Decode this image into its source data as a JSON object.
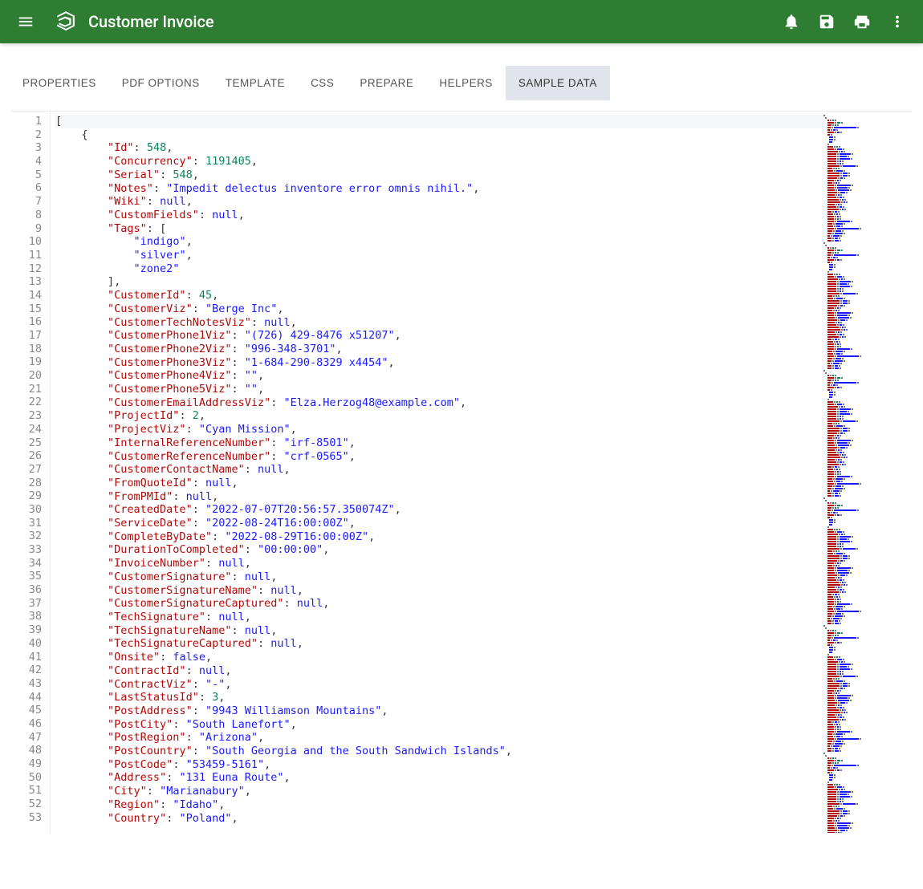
{
  "header": {
    "title": "Customer Invoice"
  },
  "tabs": [
    {
      "id": "properties",
      "label": "PROPERTIES",
      "active": false
    },
    {
      "id": "pdf-options",
      "label": "PDF OPTIONS",
      "active": false
    },
    {
      "id": "template",
      "label": "TEMPLATE",
      "active": false
    },
    {
      "id": "css",
      "label": "CSS",
      "active": false
    },
    {
      "id": "prepare",
      "label": "PREPARE",
      "active": false
    },
    {
      "id": "helpers",
      "label": "HELPERS",
      "active": false
    },
    {
      "id": "sample-data",
      "label": "SAMPLE DATA",
      "active": true
    }
  ],
  "editor": {
    "lines": [
      [
        {
          "t": "[",
          "c": "p"
        }
      ],
      [
        {
          "indent": 4
        },
        {
          "t": "{",
          "c": "p"
        }
      ],
      [
        {
          "indent": 8
        },
        {
          "t": "\"Id\"",
          "c": "k"
        },
        {
          "t": ": ",
          "c": "p"
        },
        {
          "t": "548",
          "c": "n"
        },
        {
          "t": ",",
          "c": "p"
        }
      ],
      [
        {
          "indent": 8
        },
        {
          "t": "\"Concurrency\"",
          "c": "k"
        },
        {
          "t": ": ",
          "c": "p"
        },
        {
          "t": "1191405",
          "c": "n"
        },
        {
          "t": ",",
          "c": "p"
        }
      ],
      [
        {
          "indent": 8
        },
        {
          "t": "\"Serial\"",
          "c": "k"
        },
        {
          "t": ": ",
          "c": "p"
        },
        {
          "t": "548",
          "c": "n"
        },
        {
          "t": ",",
          "c": "p"
        }
      ],
      [
        {
          "indent": 8
        },
        {
          "t": "\"Notes\"",
          "c": "k"
        },
        {
          "t": ": ",
          "c": "p"
        },
        {
          "t": "\"Impedit delectus inventore error omnis nihil.\"",
          "c": "s"
        },
        {
          "t": ",",
          "c": "p"
        }
      ],
      [
        {
          "indent": 8
        },
        {
          "t": "\"Wiki\"",
          "c": "k"
        },
        {
          "t": ": ",
          "c": "p"
        },
        {
          "t": "null",
          "c": "nu"
        },
        {
          "t": ",",
          "c": "p"
        }
      ],
      [
        {
          "indent": 8
        },
        {
          "t": "\"CustomFields\"",
          "c": "k"
        },
        {
          "t": ": ",
          "c": "p"
        },
        {
          "t": "null",
          "c": "nu"
        },
        {
          "t": ",",
          "c": "p"
        }
      ],
      [
        {
          "indent": 8
        },
        {
          "t": "\"Tags\"",
          "c": "k"
        },
        {
          "t": ": [",
          "c": "p"
        }
      ],
      [
        {
          "indent": 12
        },
        {
          "t": "\"indigo\"",
          "c": "s"
        },
        {
          "t": ",",
          "c": "p"
        }
      ],
      [
        {
          "indent": 12
        },
        {
          "t": "\"silver\"",
          "c": "s"
        },
        {
          "t": ",",
          "c": "p"
        }
      ],
      [
        {
          "indent": 12
        },
        {
          "t": "\"zone2\"",
          "c": "s"
        }
      ],
      [
        {
          "indent": 8
        },
        {
          "t": "],",
          "c": "p"
        }
      ],
      [
        {
          "indent": 8
        },
        {
          "t": "\"CustomerId\"",
          "c": "k"
        },
        {
          "t": ": ",
          "c": "p"
        },
        {
          "t": "45",
          "c": "n"
        },
        {
          "t": ",",
          "c": "p"
        }
      ],
      [
        {
          "indent": 8
        },
        {
          "t": "\"CustomerViz\"",
          "c": "k"
        },
        {
          "t": ": ",
          "c": "p"
        },
        {
          "t": "\"Berge Inc\"",
          "c": "s"
        },
        {
          "t": ",",
          "c": "p"
        }
      ],
      [
        {
          "indent": 8
        },
        {
          "t": "\"CustomerTechNotesViz\"",
          "c": "k"
        },
        {
          "t": ": ",
          "c": "p"
        },
        {
          "t": "null",
          "c": "nu"
        },
        {
          "t": ",",
          "c": "p"
        }
      ],
      [
        {
          "indent": 8
        },
        {
          "t": "\"CustomerPhone1Viz\"",
          "c": "k"
        },
        {
          "t": ": ",
          "c": "p"
        },
        {
          "t": "\"(726) 429-8476 x51207\"",
          "c": "s"
        },
        {
          "t": ",",
          "c": "p"
        }
      ],
      [
        {
          "indent": 8
        },
        {
          "t": "\"CustomerPhone2Viz\"",
          "c": "k"
        },
        {
          "t": ": ",
          "c": "p"
        },
        {
          "t": "\"996-348-3701\"",
          "c": "s"
        },
        {
          "t": ",",
          "c": "p"
        }
      ],
      [
        {
          "indent": 8
        },
        {
          "t": "\"CustomerPhone3Viz\"",
          "c": "k"
        },
        {
          "t": ": ",
          "c": "p"
        },
        {
          "t": "\"1-684-290-8329 x4454\"",
          "c": "s"
        },
        {
          "t": ",",
          "c": "p"
        }
      ],
      [
        {
          "indent": 8
        },
        {
          "t": "\"CustomerPhone4Viz\"",
          "c": "k"
        },
        {
          "t": ": ",
          "c": "p"
        },
        {
          "t": "\"\"",
          "c": "s"
        },
        {
          "t": ",",
          "c": "p"
        }
      ],
      [
        {
          "indent": 8
        },
        {
          "t": "\"CustomerPhone5Viz\"",
          "c": "k"
        },
        {
          "t": ": ",
          "c": "p"
        },
        {
          "t": "\"\"",
          "c": "s"
        },
        {
          "t": ",",
          "c": "p"
        }
      ],
      [
        {
          "indent": 8
        },
        {
          "t": "\"CustomerEmailAddressViz\"",
          "c": "k"
        },
        {
          "t": ": ",
          "c": "p"
        },
        {
          "t": "\"Elza.Herzog48@example.com\"",
          "c": "s"
        },
        {
          "t": ",",
          "c": "p"
        }
      ],
      [
        {
          "indent": 8
        },
        {
          "t": "\"ProjectId\"",
          "c": "k"
        },
        {
          "t": ": ",
          "c": "p"
        },
        {
          "t": "2",
          "c": "n"
        },
        {
          "t": ",",
          "c": "p"
        }
      ],
      [
        {
          "indent": 8
        },
        {
          "t": "\"ProjectViz\"",
          "c": "k"
        },
        {
          "t": ": ",
          "c": "p"
        },
        {
          "t": "\"Cyan Mission\"",
          "c": "s"
        },
        {
          "t": ",",
          "c": "p"
        }
      ],
      [
        {
          "indent": 8
        },
        {
          "t": "\"InternalReferenceNumber\"",
          "c": "k"
        },
        {
          "t": ": ",
          "c": "p"
        },
        {
          "t": "\"irf-8501\"",
          "c": "s"
        },
        {
          "t": ",",
          "c": "p"
        }
      ],
      [
        {
          "indent": 8
        },
        {
          "t": "\"CustomerReferenceNumber\"",
          "c": "k"
        },
        {
          "t": ": ",
          "c": "p"
        },
        {
          "t": "\"crf-0565\"",
          "c": "s"
        },
        {
          "t": ",",
          "c": "p"
        }
      ],
      [
        {
          "indent": 8
        },
        {
          "t": "\"CustomerContactName\"",
          "c": "k"
        },
        {
          "t": ": ",
          "c": "p"
        },
        {
          "t": "null",
          "c": "nu"
        },
        {
          "t": ",",
          "c": "p"
        }
      ],
      [
        {
          "indent": 8
        },
        {
          "t": "\"FromQuoteId\"",
          "c": "k"
        },
        {
          "t": ": ",
          "c": "p"
        },
        {
          "t": "null",
          "c": "nu"
        },
        {
          "t": ",",
          "c": "p"
        }
      ],
      [
        {
          "indent": 8
        },
        {
          "t": "\"FromPMId\"",
          "c": "k"
        },
        {
          "t": ": ",
          "c": "p"
        },
        {
          "t": "null",
          "c": "nu"
        },
        {
          "t": ",",
          "c": "p"
        }
      ],
      [
        {
          "indent": 8
        },
        {
          "t": "\"CreatedDate\"",
          "c": "k"
        },
        {
          "t": ": ",
          "c": "p"
        },
        {
          "t": "\"2022-07-07T20:56:57.350074Z\"",
          "c": "s"
        },
        {
          "t": ",",
          "c": "p"
        }
      ],
      [
        {
          "indent": 8
        },
        {
          "t": "\"ServiceDate\"",
          "c": "k"
        },
        {
          "t": ": ",
          "c": "p"
        },
        {
          "t": "\"2022-08-24T16:00:00Z\"",
          "c": "s"
        },
        {
          "t": ",",
          "c": "p"
        }
      ],
      [
        {
          "indent": 8
        },
        {
          "t": "\"CompleteByDate\"",
          "c": "k"
        },
        {
          "t": ": ",
          "c": "p"
        },
        {
          "t": "\"2022-08-29T16:00:00Z\"",
          "c": "s"
        },
        {
          "t": ",",
          "c": "p"
        }
      ],
      [
        {
          "indent": 8
        },
        {
          "t": "\"DurationToCompleted\"",
          "c": "k"
        },
        {
          "t": ": ",
          "c": "p"
        },
        {
          "t": "\"00:00:00\"",
          "c": "s"
        },
        {
          "t": ",",
          "c": "p"
        }
      ],
      [
        {
          "indent": 8
        },
        {
          "t": "\"InvoiceNumber\"",
          "c": "k"
        },
        {
          "t": ": ",
          "c": "p"
        },
        {
          "t": "null",
          "c": "nu"
        },
        {
          "t": ",",
          "c": "p"
        }
      ],
      [
        {
          "indent": 8
        },
        {
          "t": "\"CustomerSignature\"",
          "c": "k"
        },
        {
          "t": ": ",
          "c": "p"
        },
        {
          "t": "null",
          "c": "nu"
        },
        {
          "t": ",",
          "c": "p"
        }
      ],
      [
        {
          "indent": 8
        },
        {
          "t": "\"CustomerSignatureName\"",
          "c": "k"
        },
        {
          "t": ": ",
          "c": "p"
        },
        {
          "t": "null",
          "c": "nu"
        },
        {
          "t": ",",
          "c": "p"
        }
      ],
      [
        {
          "indent": 8
        },
        {
          "t": "\"CustomerSignatureCaptured\"",
          "c": "k"
        },
        {
          "t": ": ",
          "c": "p"
        },
        {
          "t": "null",
          "c": "nu"
        },
        {
          "t": ",",
          "c": "p"
        }
      ],
      [
        {
          "indent": 8
        },
        {
          "t": "\"TechSignature\"",
          "c": "k"
        },
        {
          "t": ": ",
          "c": "p"
        },
        {
          "t": "null",
          "c": "nu"
        },
        {
          "t": ",",
          "c": "p"
        }
      ],
      [
        {
          "indent": 8
        },
        {
          "t": "\"TechSignatureName\"",
          "c": "k"
        },
        {
          "t": ": ",
          "c": "p"
        },
        {
          "t": "null",
          "c": "nu"
        },
        {
          "t": ",",
          "c": "p"
        }
      ],
      [
        {
          "indent": 8
        },
        {
          "t": "\"TechSignatureCaptured\"",
          "c": "k"
        },
        {
          "t": ": ",
          "c": "p"
        },
        {
          "t": "null",
          "c": "nu"
        },
        {
          "t": ",",
          "c": "p"
        }
      ],
      [
        {
          "indent": 8
        },
        {
          "t": "\"Onsite\"",
          "c": "k"
        },
        {
          "t": ": ",
          "c": "p"
        },
        {
          "t": "false",
          "c": "nu"
        },
        {
          "t": ",",
          "c": "p"
        }
      ],
      [
        {
          "indent": 8
        },
        {
          "t": "\"ContractId\"",
          "c": "k"
        },
        {
          "t": ": ",
          "c": "p"
        },
        {
          "t": "null",
          "c": "nu"
        },
        {
          "t": ",",
          "c": "p"
        }
      ],
      [
        {
          "indent": 8
        },
        {
          "t": "\"ContractViz\"",
          "c": "k"
        },
        {
          "t": ": ",
          "c": "p"
        },
        {
          "t": "\"-\"",
          "c": "s"
        },
        {
          "t": ",",
          "c": "p"
        }
      ],
      [
        {
          "indent": 8
        },
        {
          "t": "\"LastStatusId\"",
          "c": "k"
        },
        {
          "t": ": ",
          "c": "p"
        },
        {
          "t": "3",
          "c": "n"
        },
        {
          "t": ",",
          "c": "p"
        }
      ],
      [
        {
          "indent": 8
        },
        {
          "t": "\"PostAddress\"",
          "c": "k"
        },
        {
          "t": ": ",
          "c": "p"
        },
        {
          "t": "\"9943 Williamson Mountains\"",
          "c": "s"
        },
        {
          "t": ",",
          "c": "p"
        }
      ],
      [
        {
          "indent": 8
        },
        {
          "t": "\"PostCity\"",
          "c": "k"
        },
        {
          "t": ": ",
          "c": "p"
        },
        {
          "t": "\"South Lanefort\"",
          "c": "s"
        },
        {
          "t": ",",
          "c": "p"
        }
      ],
      [
        {
          "indent": 8
        },
        {
          "t": "\"PostRegion\"",
          "c": "k"
        },
        {
          "t": ": ",
          "c": "p"
        },
        {
          "t": "\"Arizona\"",
          "c": "s"
        },
        {
          "t": ",",
          "c": "p"
        }
      ],
      [
        {
          "indent": 8
        },
        {
          "t": "\"PostCountry\"",
          "c": "k"
        },
        {
          "t": ": ",
          "c": "p"
        },
        {
          "t": "\"South Georgia and the South Sandwich Islands\"",
          "c": "s"
        },
        {
          "t": ",",
          "c": "p"
        }
      ],
      [
        {
          "indent": 8
        },
        {
          "t": "\"PostCode\"",
          "c": "k"
        },
        {
          "t": ": ",
          "c": "p"
        },
        {
          "t": "\"53459-5161\"",
          "c": "s"
        },
        {
          "t": ",",
          "c": "p"
        }
      ],
      [
        {
          "indent": 8
        },
        {
          "t": "\"Address\"",
          "c": "k"
        },
        {
          "t": ": ",
          "c": "p"
        },
        {
          "t": "\"131 Euna Route\"",
          "c": "s"
        },
        {
          "t": ",",
          "c": "p"
        }
      ],
      [
        {
          "indent": 8
        },
        {
          "t": "\"City\"",
          "c": "k"
        },
        {
          "t": ": ",
          "c": "p"
        },
        {
          "t": "\"Marianabury\"",
          "c": "s"
        },
        {
          "t": ",",
          "c": "p"
        }
      ],
      [
        {
          "indent": 8
        },
        {
          "t": "\"Region\"",
          "c": "k"
        },
        {
          "t": ": ",
          "c": "p"
        },
        {
          "t": "\"Idaho\"",
          "c": "s"
        },
        {
          "t": ",",
          "c": "p"
        }
      ],
      [
        {
          "indent": 8
        },
        {
          "t": "\"Country\"",
          "c": "k"
        },
        {
          "t": ": ",
          "c": "p"
        },
        {
          "t": "\"Poland\"",
          "c": "s"
        },
        {
          "t": ",",
          "c": "p"
        }
      ]
    ]
  }
}
